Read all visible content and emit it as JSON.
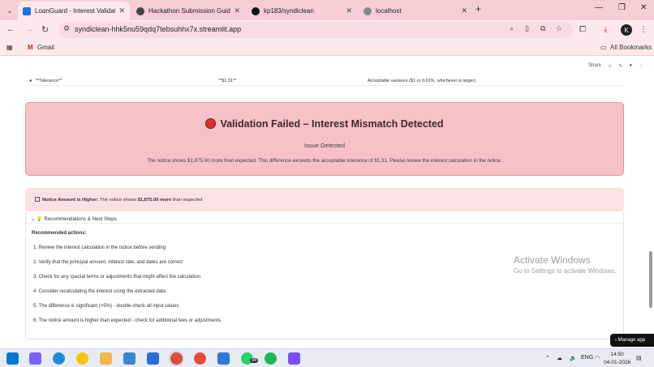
{
  "browser": {
    "tabs": [
      {
        "title": "LoanGuard - Interest Validator",
        "active": true
      },
      {
        "title": "Hackathon Submission Guidelines",
        "active": false
      },
      {
        "title": "kp183/syndiclean",
        "active": false
      },
      {
        "title": "localhost",
        "active": false
      }
    ],
    "url": "syndiclean-hhk5nu59qdq7tebsuhhx7x.streamlit.app",
    "profile_initial": "K",
    "bookmarks": {
      "gmail": "Gmail",
      "all": "All Bookmarks"
    }
  },
  "app": {
    "header": {
      "share": "Share"
    },
    "table_row": {
      "field": "**Tolerance**",
      "value": "**$1.31**",
      "note": "Acceptable variance ($1 or 0.01%, whichever is larger)"
    },
    "status": {
      "title": "Validation Failed – Interest Mismatch Detected",
      "subtitle": "Issue Detected",
      "message": "The notice shows $1,875.00 more than expected. This difference exceeds the acceptable tolerance of $1.31. Please review the interest calculation in the notice."
    },
    "notice": {
      "bold": "Notice Amount is Higher:",
      "text_pre": "The notice shows ",
      "amount": "$1,875.00 more",
      "text_post": " than expected"
    },
    "recommendations": {
      "title": "Recommendations & Next Steps",
      "label": "Recommended actions:",
      "items": [
        "1.  Review the interest calculation in the notice before sending",
        "2.  Verify that the principal amount, interest rate, and dates are correct",
        "3.  Check for any special terms or adjustments that might affect the calculation",
        "4.  Consider recalculating the interest using the extracted data",
        "5.  The difference is significant (>5%) - double-check all input values",
        "6.  The notice amount is higher than expected - check for additional fees or adjustments"
      ]
    },
    "manage_app": "Manage app"
  },
  "watermark": {
    "line1": "Activate Windows",
    "line2": "Go to Settings to activate Windows."
  },
  "taskbar": {
    "badge": "94",
    "language": "ENG",
    "time": "14:50",
    "date": "04-01-2026"
  }
}
